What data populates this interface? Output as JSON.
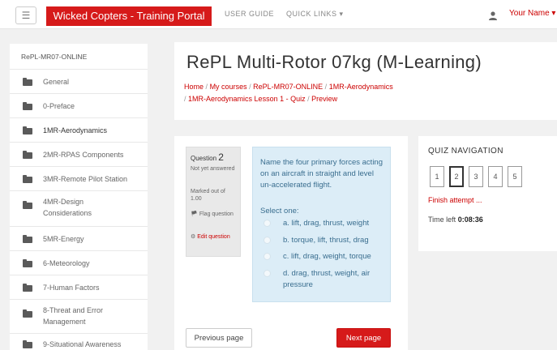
{
  "navbar": {
    "menu_icon": "hamburger-icon",
    "brand": "Wicked Copters - Training Portal",
    "links": [
      "USER GUIDE",
      "QUICK LINKS ▾"
    ],
    "user_icon": "user-icon",
    "user_name": "Your Name ▾"
  },
  "sidebar": {
    "course_code": "RePL-MR07-ONLINE",
    "items": [
      {
        "label": "General",
        "icon": "folder-icon"
      },
      {
        "label": "0-Preface",
        "icon": "folder-icon"
      },
      {
        "label": "1MR-Aerodynamics",
        "icon": "folder-icon",
        "active": true
      },
      {
        "label": "2MR-RPAS Components",
        "icon": "folder-icon"
      },
      {
        "label": "3MR-Remote Pilot Station",
        "icon": "folder-icon"
      },
      {
        "label": "4MR-Design Considerations",
        "icon": "folder-icon"
      },
      {
        "label": "5MR-Energy",
        "icon": "folder-icon"
      },
      {
        "label": "6-Meteorology",
        "icon": "folder-icon"
      },
      {
        "label": "7-Human Factors",
        "icon": "folder-icon"
      },
      {
        "label": "8-Threat and Error Management",
        "icon": "folder-icon"
      },
      {
        "label": "9-Situational Awareness",
        "icon": "folder-icon"
      }
    ]
  },
  "header": {
    "title": "RePL Multi-Rotor 07kg (M-Learning)",
    "breadcrumb": [
      "Home",
      "My courses",
      "RePL-MR07-ONLINE",
      "1MR-Aerodynamics",
      "1MR-Aerodynamics Lesson 1 - Quiz",
      "Preview"
    ],
    "separator": "/"
  },
  "question": {
    "label": "Question",
    "number": "2",
    "status": "Not yet answered",
    "marks": "Marked out of 1.00",
    "flag": "Flag question",
    "flag_icon": "flag-icon",
    "edit": "Edit question",
    "edit_icon": "gear-icon",
    "text": "Name the four primary forces acting on an aircraft in straight and level un-accelerated flight.",
    "select_one": "Select one:",
    "options": [
      "a. lift, drag, thrust, weight",
      "b. torque, lift, thrust, drag",
      "c. lift, drag, weight, torque",
      "d. drag, thrust, weight, air pressure"
    ]
  },
  "buttons": {
    "previous": "Previous page",
    "next": "Next page"
  },
  "quiz_nav": {
    "title": "QUIZ NAVIGATION",
    "questions": [
      "1",
      "2",
      "3",
      "4",
      "5"
    ],
    "current": "2",
    "finish": "Finish attempt ...",
    "time_label": "Time left",
    "time_value": "0:08:36"
  },
  "colors": {
    "brand": "#d61a1a",
    "link": "#cc0000",
    "question_bg": "#dcedf7",
    "question_text": "#3a6e8f"
  }
}
